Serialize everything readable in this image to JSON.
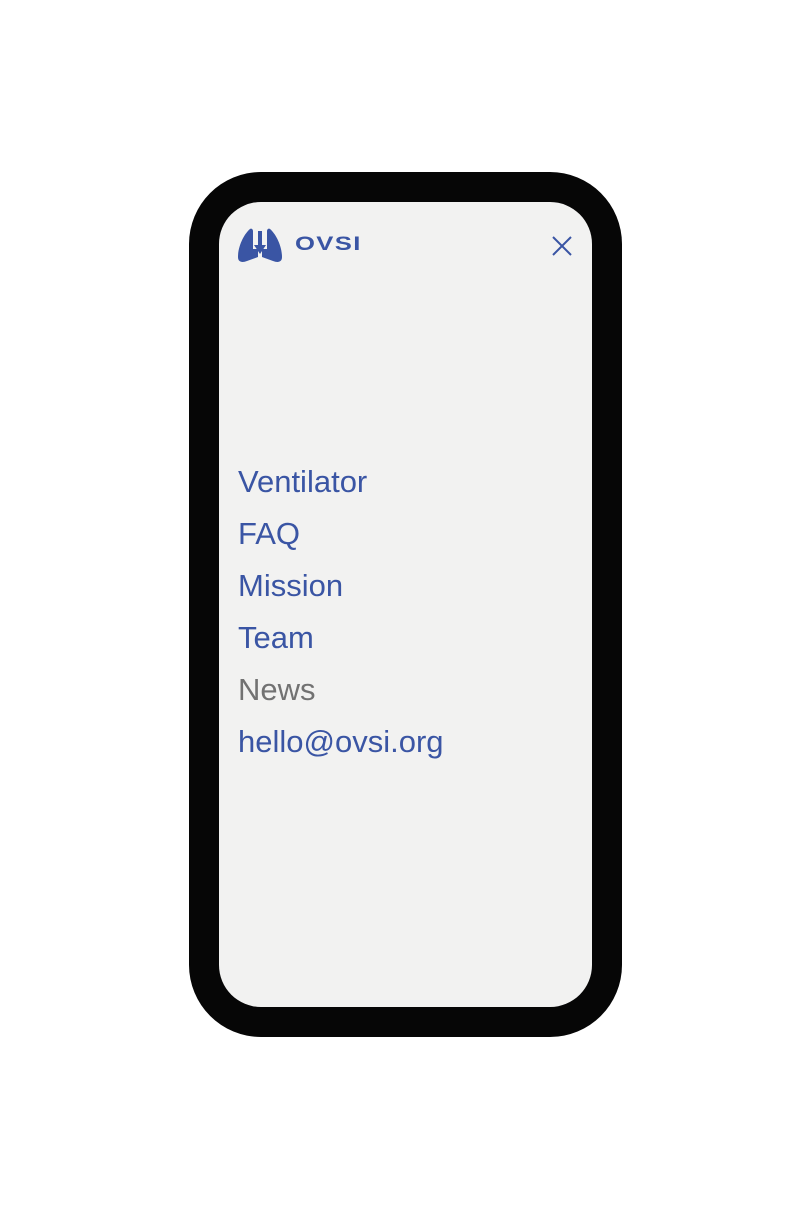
{
  "brand": {
    "name": "OVSI",
    "color": "#3a55a4"
  },
  "header": {
    "close_icon": "close-icon"
  },
  "menu": {
    "items": [
      {
        "label": "Ventilator",
        "active": false
      },
      {
        "label": "FAQ",
        "active": false
      },
      {
        "label": "Mission",
        "active": false
      },
      {
        "label": "Team",
        "active": false
      },
      {
        "label": "News",
        "active": true
      },
      {
        "label": "hello@ovsi.org",
        "active": false
      }
    ]
  },
  "colors": {
    "link": "#3a55a4",
    "current": "#727272",
    "background": "#f2f2f1"
  }
}
